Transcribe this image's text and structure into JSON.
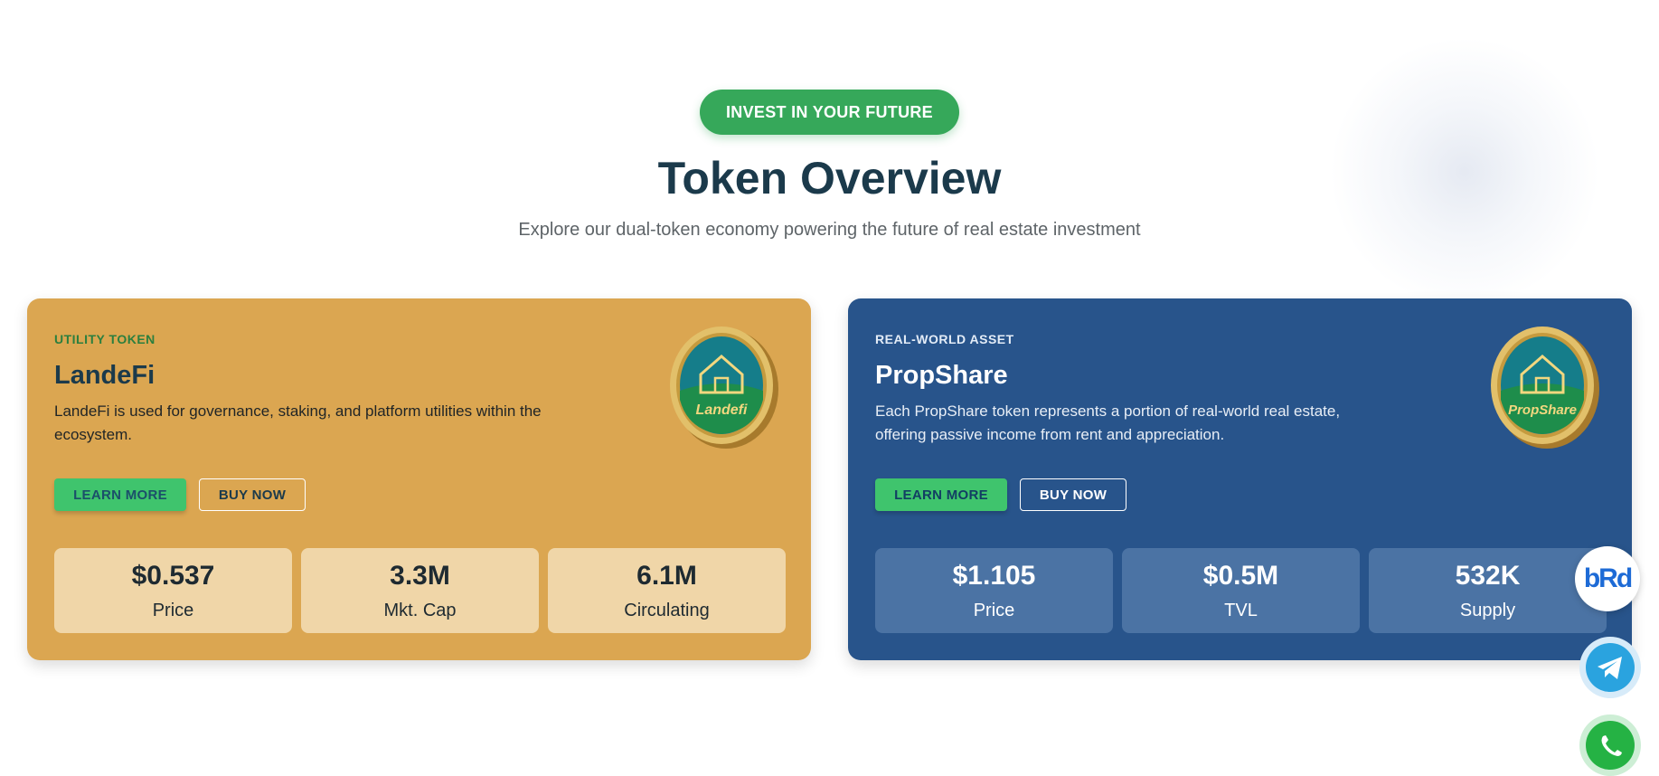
{
  "header": {
    "badge": "INVEST IN YOUR FUTURE",
    "title": "Token Overview",
    "subtitle": "Explore our dual-token economy powering the future of real estate investment"
  },
  "cards": [
    {
      "tag": "UTILITY TOKEN",
      "name": "LandeFi",
      "description": "LandeFi is used for governance, staking, and platform utilities within the ecosystem.",
      "learn_label": "LEARN MORE",
      "buy_label": "BUY NOW",
      "coin_text": "Landefi",
      "stats": [
        {
          "value": "$0.537",
          "label": "Price"
        },
        {
          "value": "3.3M",
          "label": "Mkt. Cap"
        },
        {
          "value": "6.1M",
          "label": "Circulating"
        }
      ]
    },
    {
      "tag": "REAL-WORLD ASSET",
      "name": "PropShare",
      "description": "Each PropShare token represents a portion of real-world real estate, offering passive income from rent and appreciation.",
      "learn_label": "LEARN MORE",
      "buy_label": "BUY NOW",
      "coin_text": "PropShare",
      "stats": [
        {
          "value": "$1.105",
          "label": "Price"
        },
        {
          "value": "$0.5M",
          "label": "TVL"
        },
        {
          "value": "532K",
          "label": "Supply"
        }
      ]
    }
  ],
  "floating": {
    "brd_logo": "bRd",
    "telegram_icon": "telegram-icon",
    "whatsapp_icon": "whatsapp-icon"
  },
  "colors": {
    "accent_green": "#36a85a",
    "gold_card": "#dba651",
    "blue_card": "#28548b",
    "title": "#1b3a4b"
  }
}
